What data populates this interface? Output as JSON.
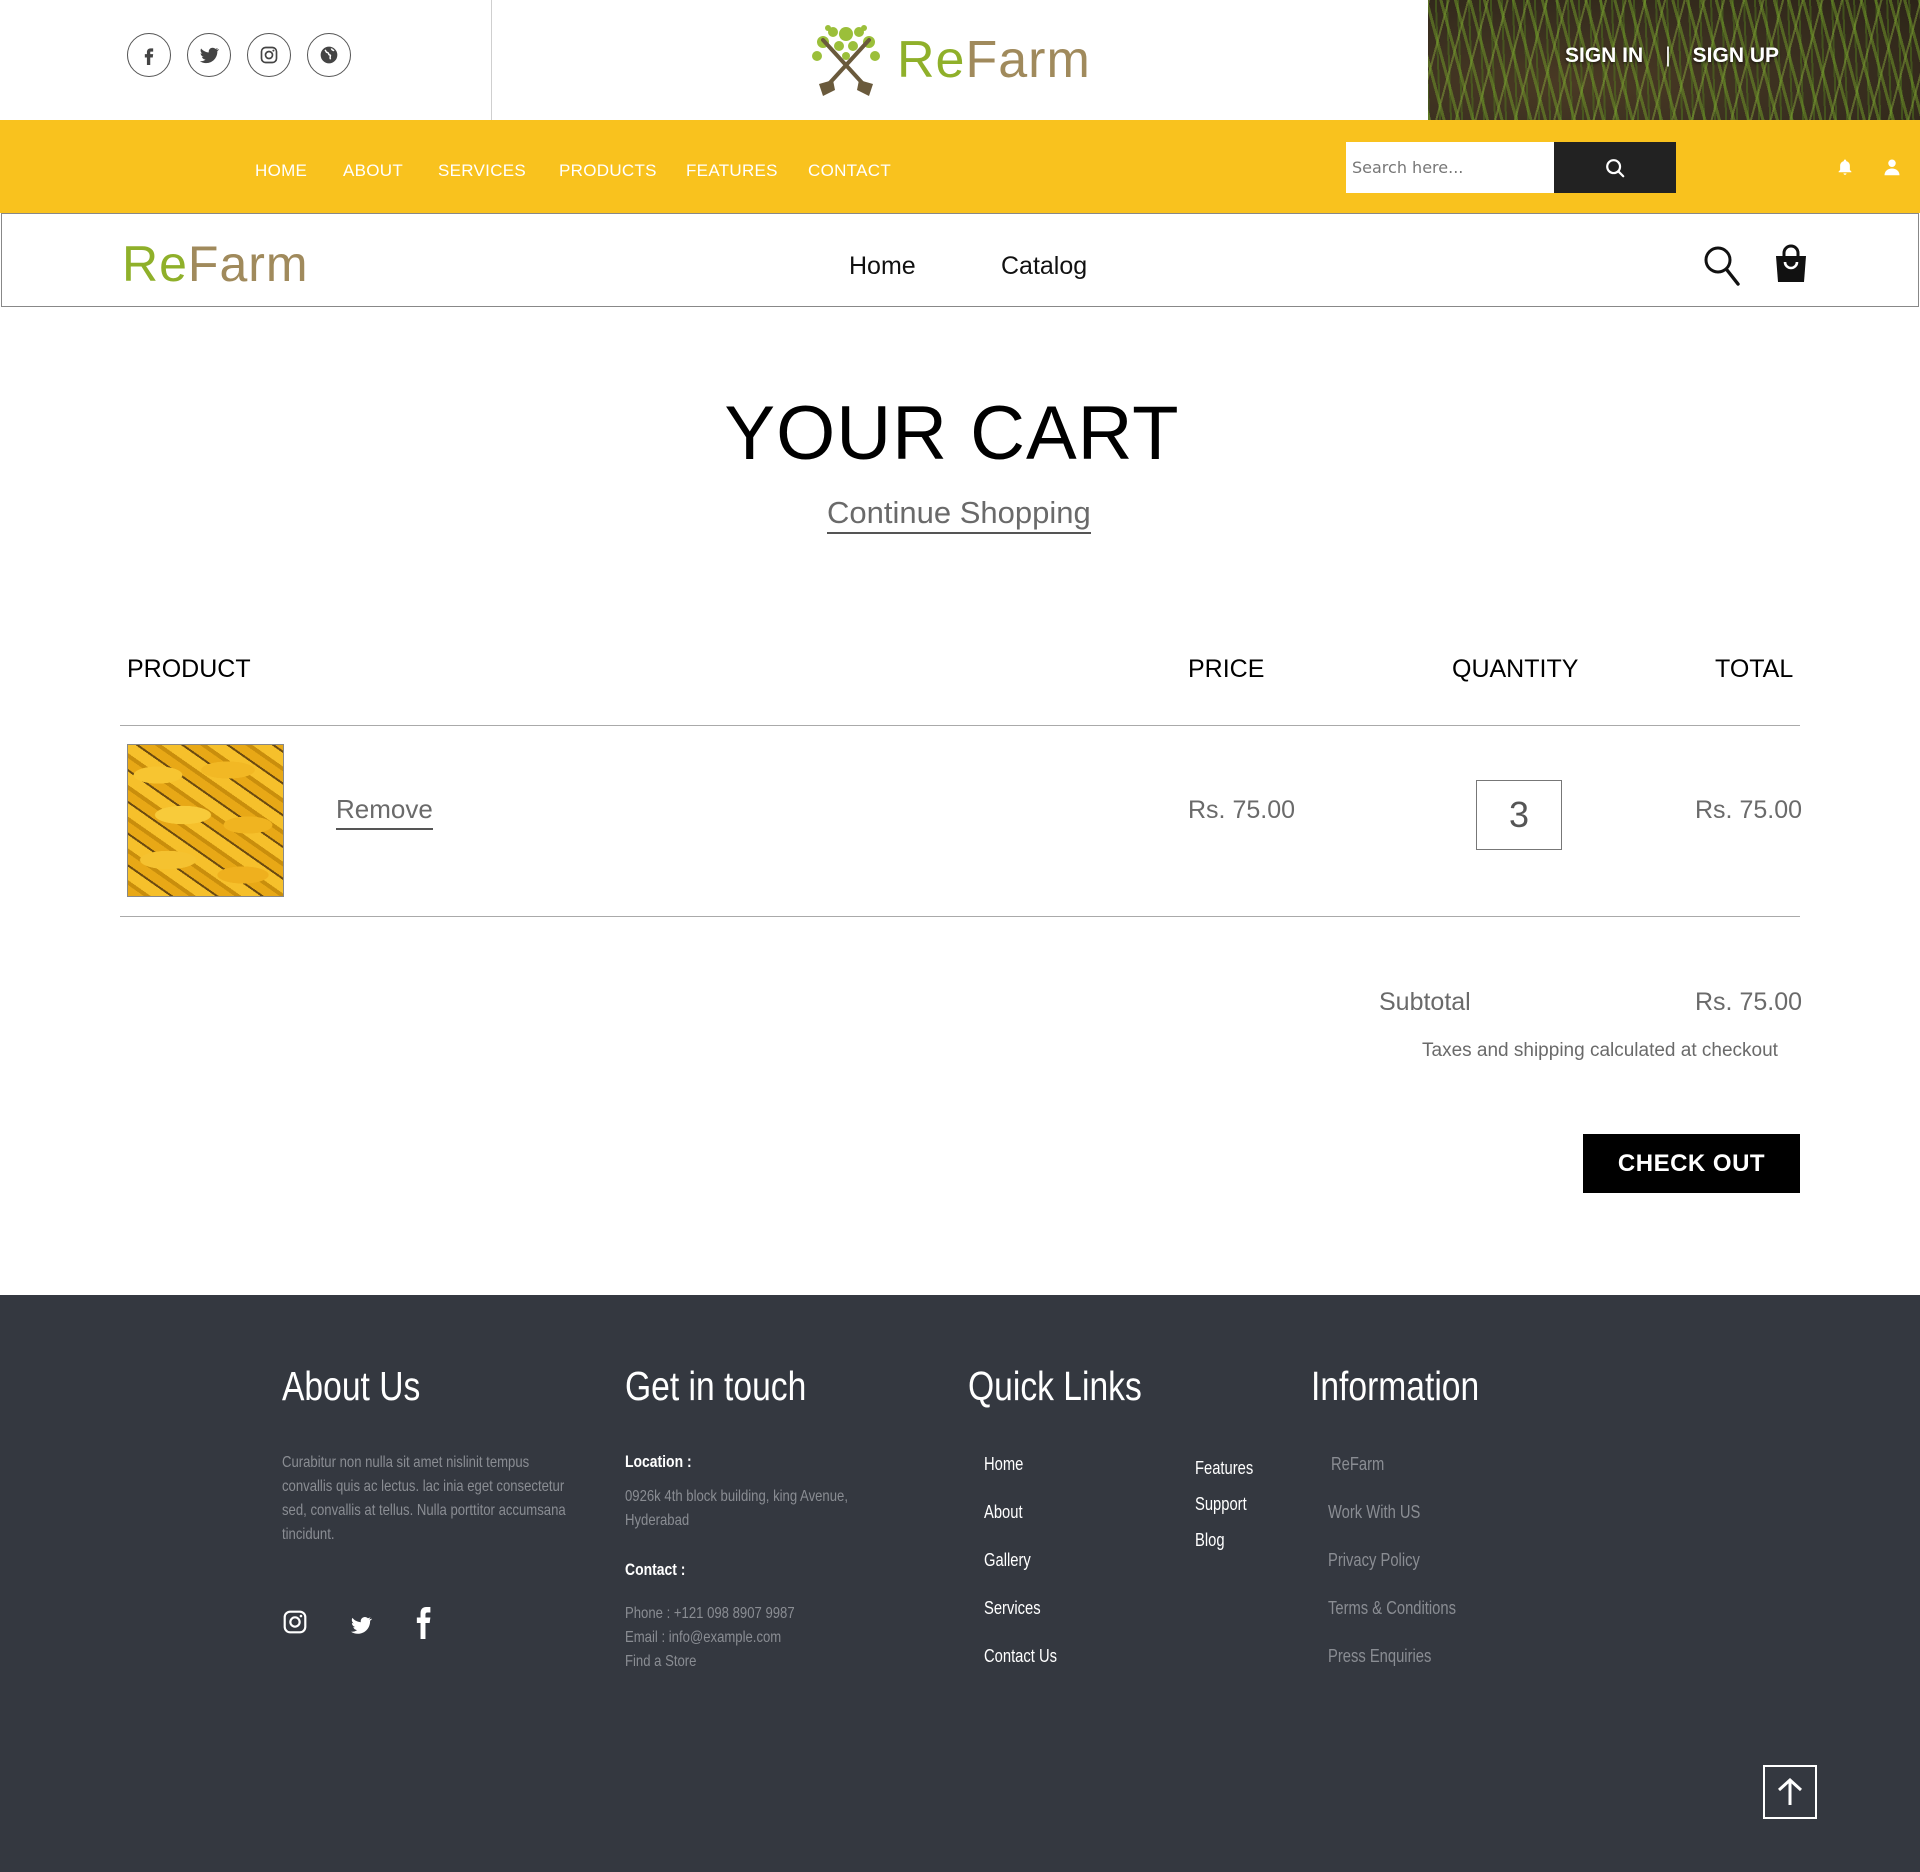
{
  "topbar": {
    "social_icons": [
      "facebook-icon",
      "twitter-icon",
      "instagram-icon",
      "globe-icon"
    ],
    "brand": {
      "re": "Re",
      "farm": "Farm"
    },
    "auth": {
      "sign_in": "SIGN IN",
      "separator": "|",
      "sign_up": "SIGN UP"
    }
  },
  "yellow_nav": {
    "items": [
      "HOME",
      "ABOUT",
      "SERVICES",
      "PRODUCTS",
      "FEATURES",
      "CONTACT"
    ],
    "search_placeholder": "Search here...",
    "icons": [
      "search-icon",
      "bell-icon",
      "user-icon"
    ]
  },
  "header": {
    "brand": {
      "re": "Re",
      "farm": "Farm"
    },
    "nav": [
      "Home",
      "Catalog"
    ],
    "icons": [
      "search-icon",
      "shopping-bag-icon"
    ]
  },
  "cart": {
    "title": "YOUR CART",
    "continue_shopping": "Continue Shopping",
    "columns": {
      "product": "PRODUCT",
      "price": "PRICE",
      "quantity": "QUANTITY",
      "total": "TOTAL"
    },
    "items": [
      {
        "image": "bananas",
        "remove_label": "Remove",
        "price": "Rs. 75.00",
        "quantity": "3",
        "total": "Rs. 75.00"
      }
    ],
    "subtotal_label": "Subtotal",
    "subtotal_value": "Rs. 75.00",
    "tax_note": "Taxes and shipping calculated at checkout",
    "checkout_label": "CHECK OUT"
  },
  "footer": {
    "about": {
      "heading": "About Us",
      "text": "Curabitur non nulla sit amet nislinit tempus convallis quis ac lectus. lac inia eget consectetur sed, convallis at tellus. Nulla porttitor accumsana tincidunt.",
      "social_icons": [
        "instagram-icon",
        "twitter-icon",
        "facebook-icon"
      ]
    },
    "contact": {
      "heading": "Get in touch",
      "location_label": "Location :",
      "location_line1": "0926k 4th block building, king Avenue,",
      "location_line2": "Hyderabad",
      "contact_label": "Contact :",
      "phone": "Phone : +121 098 8907 9987",
      "email": "Email : info@example.com",
      "store": "Find a Store"
    },
    "quick_links": {
      "heading": "Quick Links",
      "col1": [
        "Home",
        "About",
        "Gallery",
        "Services",
        "Contact Us"
      ],
      "col2": [
        "Features",
        "Support",
        "Blog"
      ]
    },
    "information": {
      "heading": "Information",
      "links": [
        "ReFarm",
        "Work With US",
        "Privacy Policy",
        "Terms & Conditions",
        "Press Enquiries"
      ]
    },
    "back_to_top_icon": "arrow-up-icon"
  },
  "colors": {
    "nav_yellow": "#f9c21e",
    "footer_bg": "#343840",
    "brand_green": "#8fb02a",
    "brand_tan": "#a08a5c"
  }
}
